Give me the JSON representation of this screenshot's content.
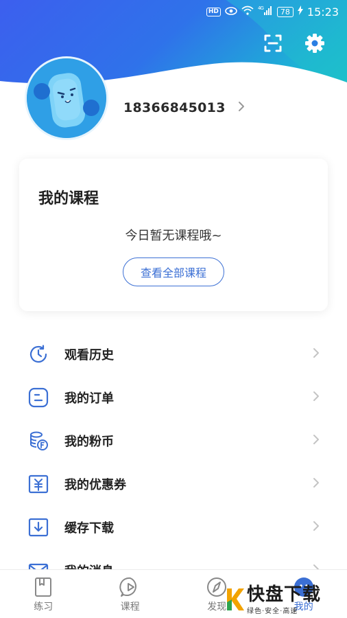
{
  "status_bar": {
    "hd": "HD",
    "network": "4G",
    "battery": "78",
    "time": "15:23"
  },
  "header": {
    "phone": "18366845013",
    "scan_icon": "scan-icon",
    "settings_icon": "gear-icon"
  },
  "course_card": {
    "title": "我的课程",
    "empty_text": "今日暂无课程哦~",
    "all_courses_label": "查看全部课程"
  },
  "menu": {
    "items": [
      {
        "label": "观看历史",
        "icon": "clock-history-icon"
      },
      {
        "label": "我的订单",
        "icon": "order-icon"
      },
      {
        "label": "我的粉币",
        "icon": "coin-icon"
      },
      {
        "label": "我的优惠券",
        "icon": "coupon-icon"
      },
      {
        "label": "缓存下载",
        "icon": "download-icon"
      },
      {
        "label": "我的消息",
        "icon": "message-icon"
      }
    ]
  },
  "bottom_nav": {
    "items": [
      {
        "label": "练习",
        "icon": "book-icon"
      },
      {
        "label": "课程",
        "icon": "play-icon"
      },
      {
        "label": "发现",
        "icon": "compass-icon"
      },
      {
        "label": "我的",
        "icon": "profile-icon"
      }
    ]
  },
  "watermark": {
    "title": "快盘下载",
    "tagline": "绿色·安全·高速"
  },
  "colors": {
    "accent": "#3b6fd4",
    "header_start": "#3d66ec",
    "header_end": "#1fb7d6",
    "watermark_k": "#f2a300"
  }
}
